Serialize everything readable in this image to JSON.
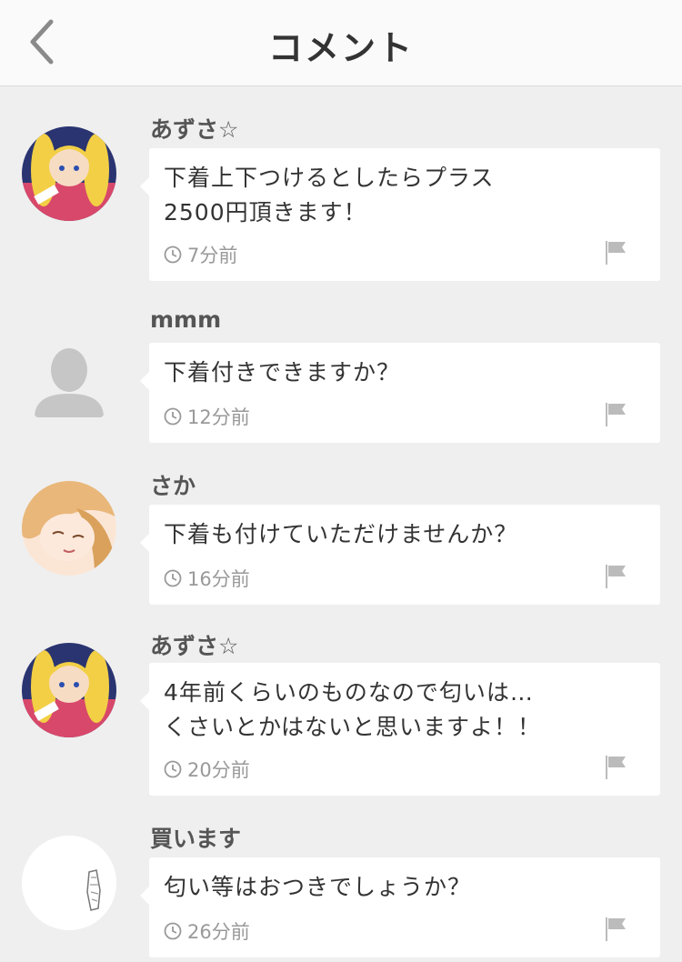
{
  "header": {
    "title": "コメント"
  },
  "comments": [
    {
      "user": "あずさ☆",
      "text": "下着上下つけるとしたらプラス2500円頂きます！",
      "time": "7分前",
      "avatar": "anime-character-avatar"
    },
    {
      "user": "mmm",
      "text": "下着付きできますか？",
      "time": "12分前",
      "avatar": "default-user-avatar"
    },
    {
      "user": "さか",
      "text": "下着も付けていただけませんか？",
      "time": "16分前",
      "avatar": "anime-character-avatar"
    },
    {
      "user": "あずさ☆",
      "text": "4年前くらいのものなので匂いは…\nくさいとかはないと思いますよ！！",
      "time": "20分前",
      "avatar": "anime-character-avatar"
    },
    {
      "user": "買います",
      "text": "匂い等はおつきでしょうか？",
      "time": "26分前",
      "avatar": "sketch-avatar"
    }
  ]
}
